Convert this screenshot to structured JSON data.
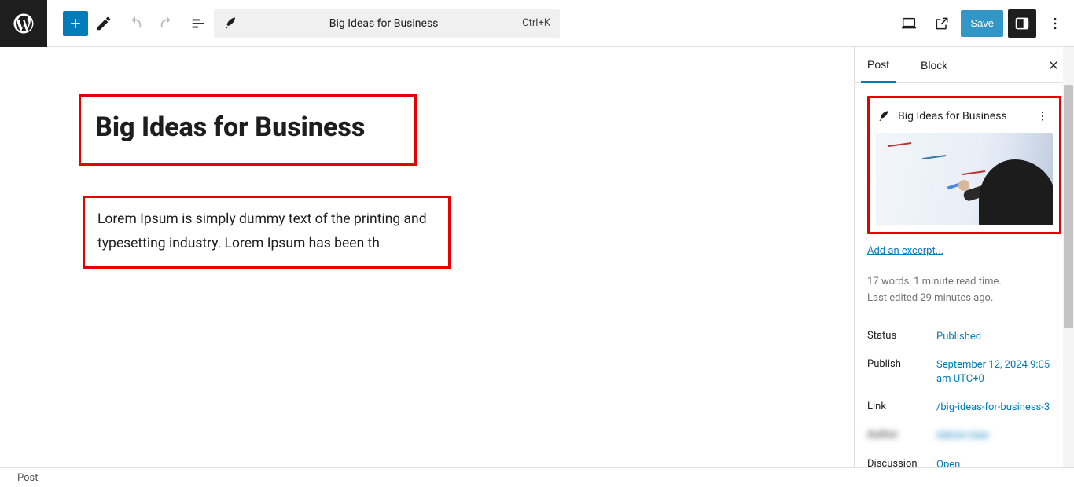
{
  "topbar": {
    "add_title": "Toggle block inserter",
    "tools_title": "Tools",
    "undo_title": "Undo",
    "redo_title": "Redo",
    "outline_title": "Document Overview",
    "doc_title": "Big Ideas for Business",
    "shortcut": "Ctrl+K",
    "view_title": "View",
    "preview_title": "Preview",
    "save_label": "Save",
    "settings_title": "Settings",
    "options_title": "Options"
  },
  "editor": {
    "post_title": "Big Ideas for Business",
    "body": "Lorem Ipsum is simply dummy text of the printing and typesetting industry. Lorem Ipsum has been th"
  },
  "sidebar": {
    "tabs": {
      "post": "Post",
      "block": "Block",
      "close": "Close settings"
    },
    "card": {
      "title": "Big Ideas for Business",
      "more": "Actions"
    },
    "excerpt": "Add an excerpt...",
    "stats_line1": "17 words, 1 minute read time.",
    "stats_line2": "Last edited 29 minutes ago.",
    "rows": {
      "status_key": "Status",
      "status_val": "Published",
      "publish_key": "Publish",
      "publish_val": "September 12, 2024 9:05 am UTC+0",
      "link_key": "Link",
      "link_val": "/big-ideas-for-business-3",
      "hidden_key": "Author",
      "hidden_val": "Admin User",
      "discussion_key": "Discussion",
      "discussion_val": "Open"
    }
  },
  "footer": {
    "breadcrumb": "Post"
  }
}
